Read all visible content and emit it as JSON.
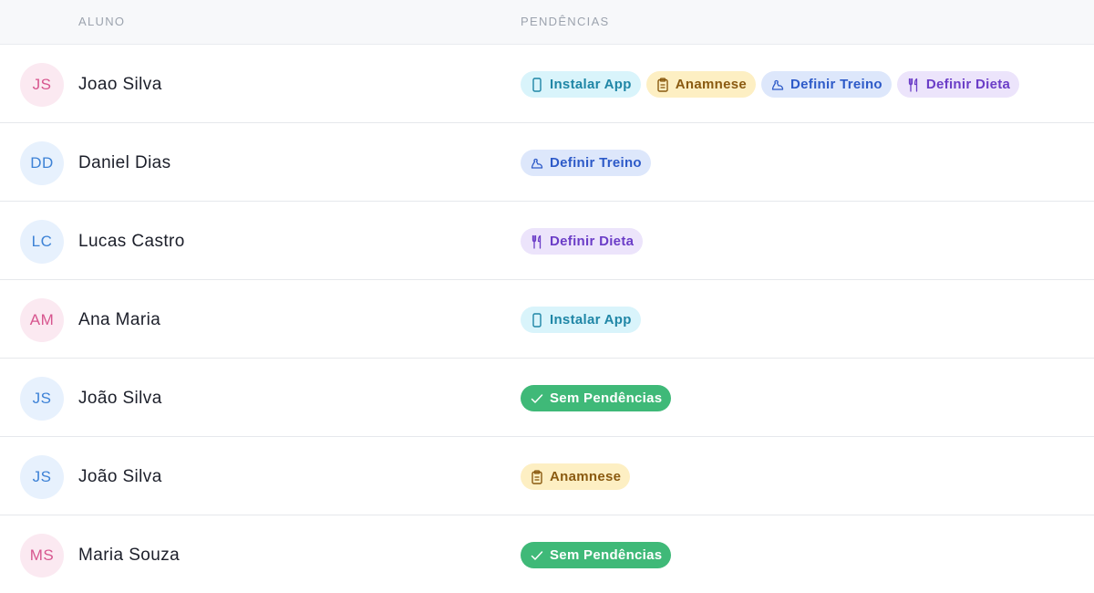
{
  "header": {
    "col_aluno": "ALUNO",
    "col_pendencias": "PENDÊNCIAS"
  },
  "badges": {
    "app": "Instalar App",
    "anamnese": "Anamnese",
    "treino": "Definir Treino",
    "dieta": "Definir Dieta",
    "ok": "Sem Pendências"
  },
  "colors": {
    "avatar_pink": "#d7558e",
    "avatar_blue": "#3d82d6",
    "ok_green": "#3fb978"
  },
  "rows": [
    {
      "initials": "JS",
      "name": "Joao Silva"
    },
    {
      "initials": "DD",
      "name": "Daniel Dias"
    },
    {
      "initials": "LC",
      "name": "Lucas Castro"
    },
    {
      "initials": "AM",
      "name": "Ana Maria"
    },
    {
      "initials": "JS",
      "name": "João Silva"
    },
    {
      "initials": "JS",
      "name": "João Silva"
    },
    {
      "initials": "MS",
      "name": "Maria Souza"
    }
  ]
}
